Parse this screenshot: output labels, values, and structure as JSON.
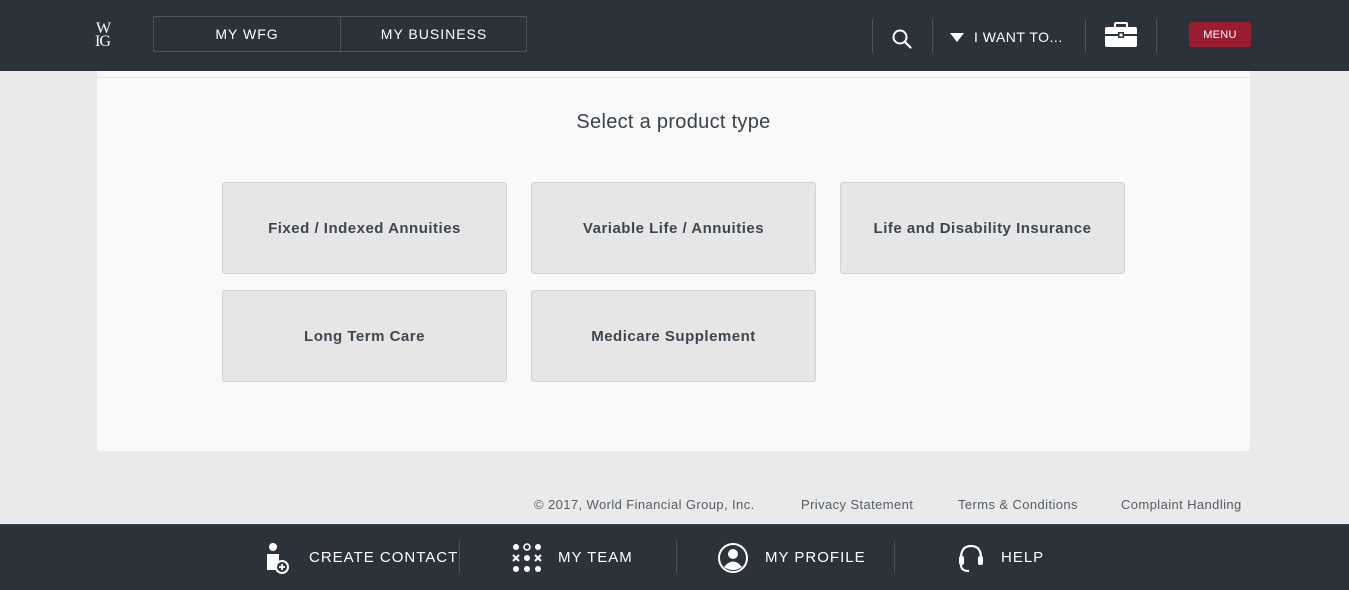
{
  "header": {
    "logo_line1": "W",
    "logo_line2": "IG",
    "tabs": [
      {
        "label": "MY WFG"
      },
      {
        "label": "MY BUSINESS"
      }
    ],
    "search_icon": "search-icon",
    "iwant_label": "I WANT TO...",
    "toolbox_icon": "toolbox-icon",
    "menu_label": "MENU",
    "colors": {
      "bar": "#2b323a",
      "menu": "#9b1b30"
    }
  },
  "main": {
    "heading": "Select a product type",
    "products": [
      {
        "label": "Fixed / Indexed Annuities"
      },
      {
        "label": "Variable Life / Annuities"
      },
      {
        "label": "Life and Disability Insurance"
      },
      {
        "label": "Long Term Care"
      },
      {
        "label": "Medicare Supplement"
      }
    ]
  },
  "footer": {
    "copyright": "© 2017, World Financial Group, Inc.",
    "privacy": "Privacy Statement",
    "terms": "Terms & Conditions",
    "complaint": "Complaint Handling"
  },
  "bottom_nav": {
    "items": [
      {
        "label": "CREATE CONTACT",
        "icon": "add-contact-icon"
      },
      {
        "label": "MY TEAM",
        "icon": "team-grid-icon"
      },
      {
        "label": "MY PROFILE",
        "icon": "profile-icon"
      },
      {
        "label": "HELP",
        "icon": "headset-icon"
      }
    ]
  }
}
